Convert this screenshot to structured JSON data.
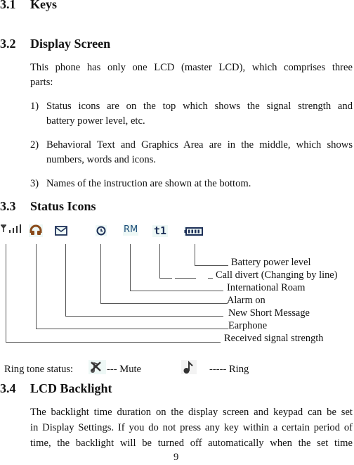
{
  "sections": {
    "s31": {
      "number": "3.1",
      "title": "Keys"
    },
    "s32": {
      "number": "3.2",
      "title": "Display Screen",
      "intro_line1": "This phone has only one LCD (master LCD), which comprises three",
      "intro_line2": "parts:",
      "items": [
        {
          "num": "1)",
          "line1": "Status icons are on the top which shows the signal strength and",
          "line2": "battery power level, etc."
        },
        {
          "num": "2)",
          "line1": "Behavioral Text and Graphics Area are in the middle, which shows",
          "line2": "numbers, words and icons."
        },
        {
          "num": "3)",
          "line1": "Names of the instruction are shown at the bottom.",
          "line2": ""
        }
      ]
    },
    "s33": {
      "number": "3.3",
      "title": "Status Icons",
      "icons": [
        {
          "icon": "signal-strength-icon",
          "label": "Received signal strength"
        },
        {
          "icon": "earphone-icon",
          "label": "Earphone"
        },
        {
          "icon": "envelope-icon",
          "label": "New Short Message"
        },
        {
          "icon": "alarm-clock-icon",
          "label": "Alarm on"
        },
        {
          "icon": "roaming-icon",
          "glyph": "RM",
          "label": "International Roam"
        },
        {
          "icon": "call-divert-icon",
          "glyph": "t1",
          "label": "Call divert (Changing by line)"
        },
        {
          "icon": "battery-icon",
          "label": "Battery power level"
        }
      ],
      "ring_tone": {
        "prefix": "Ring tone status:",
        "mute_label": "--- Mute",
        "ring_label": "----- Ring"
      }
    },
    "s34": {
      "number": "3.4",
      "title": "LCD Backlight",
      "line1": "The backlight time duration on the display screen and keypad can be set",
      "line2": "in Display Settings. If you do not press any key within a certain period of",
      "line3": "time, the backlight will be turned off automatically when the set time"
    }
  },
  "page_number": "9",
  "colors": {
    "icon_bg": "#eef8f6",
    "earphone": "#8a4a1a",
    "navy": "#1d2f57",
    "roam": "#1f4f7a"
  }
}
